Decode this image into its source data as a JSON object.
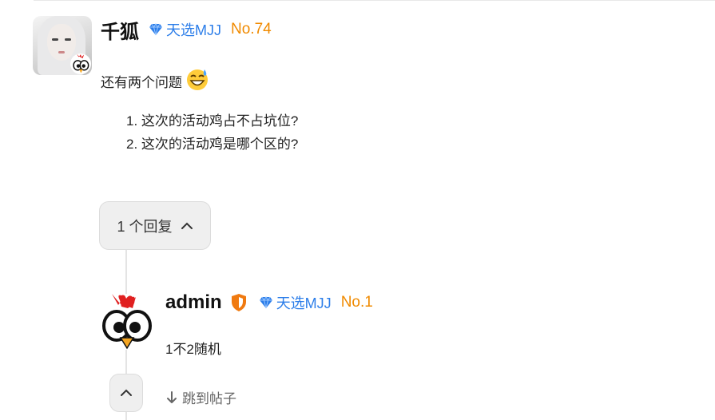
{
  "post": {
    "username": "千狐",
    "tier_label": "天选MJJ",
    "rank": "No.74",
    "text": "还有两个问题",
    "emoji": "grinning-sweat-emoji",
    "questions": [
      "1. 这次的活动鸡占不占坑位?",
      "2. 这次的活动鸡是哪个区的?"
    ]
  },
  "replies": {
    "toggle_label": "1 个回复",
    "items": [
      {
        "username": "admin",
        "tier_label": "天选MJJ",
        "rank": "No.1",
        "text": "1不2随机"
      }
    ],
    "jump_label": "跳到帖子"
  },
  "colors": {
    "tier_blue": "#2b7de9",
    "rank_orange": "#f08a00",
    "admin_shield": "#f07a10",
    "button_bg": "#efefef"
  }
}
